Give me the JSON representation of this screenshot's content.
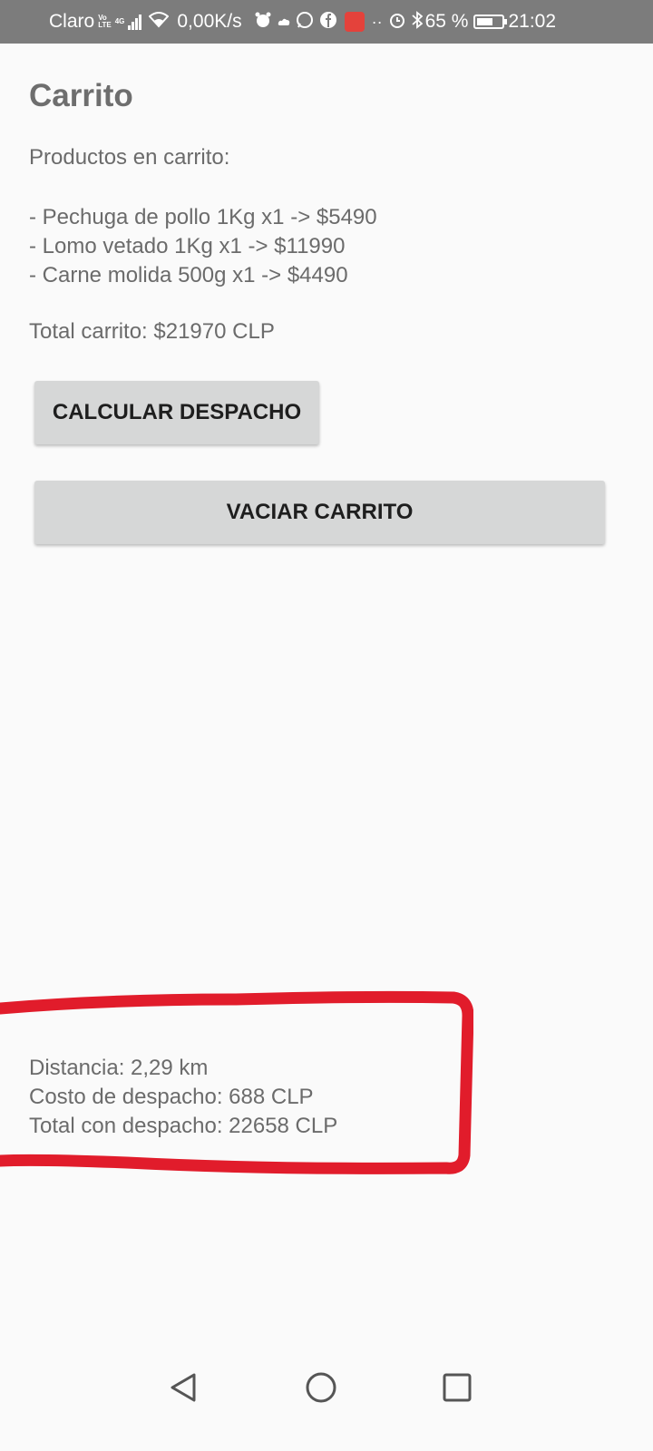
{
  "status_bar": {
    "carrier": "Claro",
    "network_top": "Vo",
    "network_bottom": "LTE",
    "network_type": "4G",
    "speed": "0,00K/s",
    "battery_percent": "65 %",
    "battery_level": 0.65,
    "time": "21:02",
    "icons": [
      "alarm-icon",
      "cloud-icon",
      "whatsapp-icon",
      "facebook-icon",
      "shop-app-icon",
      "more-icon",
      "alarm-clock-icon",
      "bluetooth-icon"
    ]
  },
  "page": {
    "title": "Carrito",
    "products_label": "Productos en carrito:",
    "products": [
      "- Pechuga de pollo 1Kg x1 -> $5490",
      "- Lomo vetado 1Kg x1 -> $11990",
      "- Carne molida 500g x1 -> $4490"
    ],
    "cart_total": "Total carrito: $21970 CLP",
    "calculate_button": "CALCULAR DESPACHO",
    "empty_button": "VACIAR CARRITO"
  },
  "shipping": {
    "distance": "Distancia: 2,29 km",
    "cost": "Costo de despacho: 688 CLP",
    "total": "Total con despacho: 22658 CLP"
  },
  "colors": {
    "background": "#fafafa",
    "status_bar": "#7c7c7c",
    "button": "#d6d7d7",
    "highlight": "#e11c2b",
    "text": "#6b6b6b"
  },
  "nav_bar": {
    "icons": [
      "back-icon",
      "home-icon",
      "recents-icon"
    ]
  }
}
